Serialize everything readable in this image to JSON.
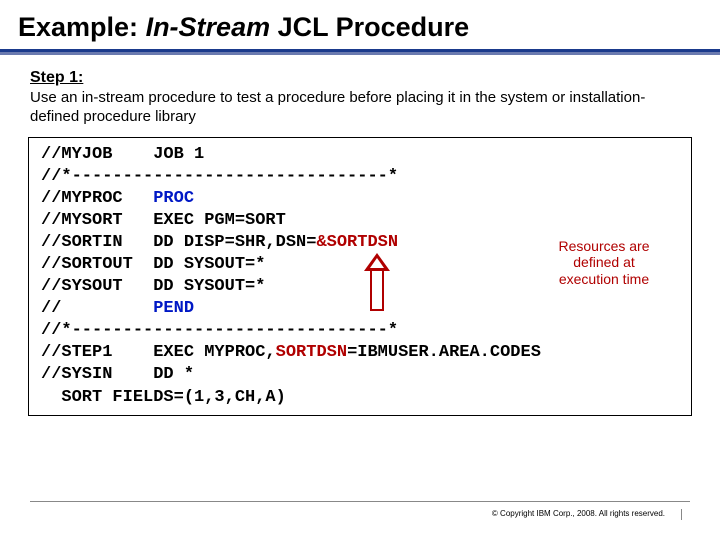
{
  "title_prefix": "Example: ",
  "title_em": "In-Stream",
  "title_suffix": " JCL Procedure",
  "step_label": "Step 1:",
  "step_desc": "Use an in-stream procedure to test a procedure before placing it in the system or installation-defined procedure library",
  "code": {
    "l1": "//MYJOB    JOB 1",
    "l2": "//*-------------------------------*",
    "l3a": "//MYPROC   ",
    "l3b": "PROC",
    "l4": "//MYSORT   EXEC PGM=SORT",
    "l5a": "//SORTIN   DD DISP=SHR,DSN=",
    "l5b": "&SORTDSN",
    "l6": "//SORTOUT  DD SYSOUT=*",
    "l7": "//SYSOUT   DD SYSOUT=*",
    "l8a": "//         ",
    "l8b": "PEND",
    "l9": "//*-------------------------------*",
    "l10a": "//STEP1    EXEC MYPROC,",
    "l10b": "SORTDSN",
    "l10c": "=IBMUSER.AREA.CODES",
    "l11": "//SYSIN    DD *",
    "l12": "  SORT FIELDS=(1,3,CH,A)"
  },
  "note_l1": "Resources are",
  "note_l2": "defined at",
  "note_l3": "execution time",
  "copyright": "© Copyright IBM Corp., 2008. All rights reserved."
}
